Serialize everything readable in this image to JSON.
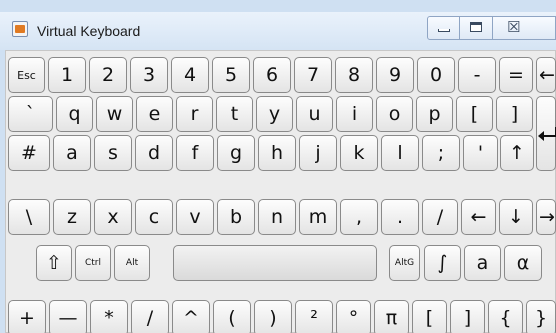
{
  "window": {
    "title": "Virtual Keyboard",
    "icon": "java-app-icon",
    "controls": {
      "minimize": "minimize-icon",
      "maximize": "maximize-icon",
      "close_glyph": "☒"
    }
  },
  "keyboard": {
    "row1": [
      "Esc",
      "1",
      "2",
      "3",
      "4",
      "5",
      "6",
      "7",
      "8",
      "9",
      "0",
      "-",
      "=",
      "←"
    ],
    "row2": [
      "`",
      "q",
      "w",
      "e",
      "r",
      "t",
      "y",
      "u",
      "i",
      "o",
      "p",
      "[",
      "]"
    ],
    "row3": [
      "#",
      "a",
      "s",
      "d",
      "f",
      "g",
      "h",
      "j",
      "k",
      "l",
      ";",
      "'",
      "↑"
    ],
    "row4": [
      "\\",
      "z",
      "x",
      "c",
      "v",
      "b",
      "n",
      "m",
      ",",
      ".",
      "/",
      "←",
      "↓",
      "→"
    ],
    "row5": {
      "shift": "⇧",
      "ctrl": "Ctrl",
      "alt": "Alt",
      "space": "",
      "altgr": "AltG",
      "integral": "∫",
      "a": "a",
      "alpha": "α"
    },
    "row6": [
      "+",
      "—",
      "*",
      "/",
      "^",
      "(",
      ")",
      "²",
      "°",
      "π",
      "[",
      "]",
      "{",
      "}"
    ],
    "enter_icon": "enter-icon"
  }
}
